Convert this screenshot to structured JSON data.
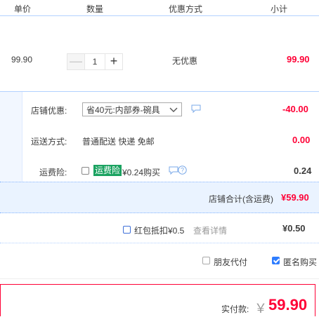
{
  "header": {
    "col_price": "单价",
    "col_qty": "数量",
    "col_discount": "优惠方式",
    "col_subtotal": "小计"
  },
  "item": {
    "price": "99.90",
    "quantity": "1",
    "minus": "—",
    "plus": "+",
    "discount": "无优惠",
    "subtotal": "99.90"
  },
  "shop": {
    "coupon_label": "店铺优惠:",
    "coupon_selected": "省40元:内部券-碗具",
    "coupon_amount": "-40.00",
    "shipping_label": "运送方式:",
    "shipping_value": "普通配送 快递 免邮",
    "shipping_amount": "0.00",
    "insurance_label": "运费险:",
    "insurance_tag": "运费险",
    "insurance_text": "¥0.24购买",
    "insurance_amount": "0.24",
    "total_label": "店铺合计(含运费)",
    "total_amount": "¥59.90"
  },
  "redpack": {
    "label": "红包抵扣¥0.5",
    "link": "查看详情",
    "amount": "¥0.50"
  },
  "options": {
    "friend_pay": "朋友代付",
    "anonymous": "匿名购买"
  },
  "payment": {
    "label": "实付款:",
    "currency": "￥",
    "amount": "59.90"
  },
  "colors": {
    "accent_red": "#ff0036",
    "border_blue": "#b2d1ff",
    "highlight_green": "#1aa260"
  }
}
